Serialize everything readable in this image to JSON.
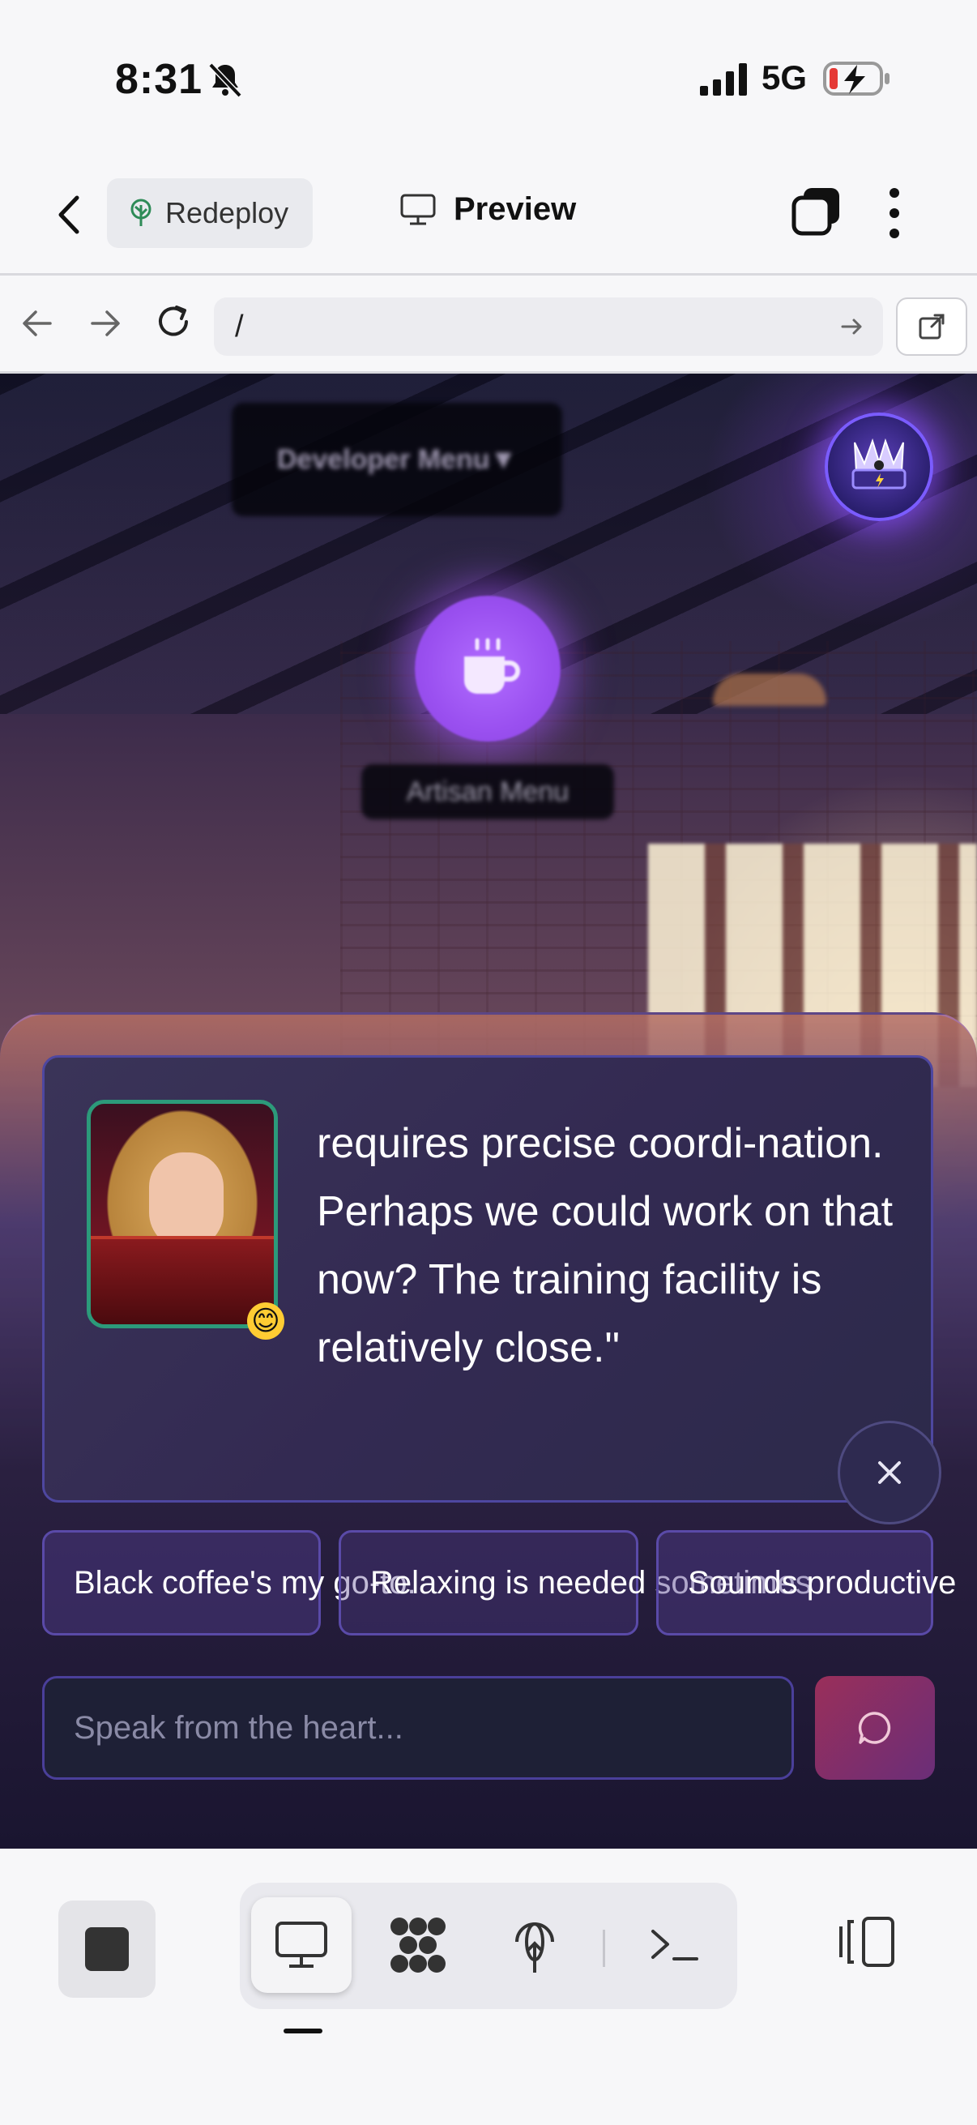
{
  "status": {
    "time": "8:31",
    "network": "5G"
  },
  "toolbar": {
    "redeploy_label": "Redeploy",
    "preview_label": "Preview"
  },
  "url_bar": {
    "value": "/"
  },
  "app": {
    "dev_menu_label": "Developer Menu▼",
    "artisan_menu_label": "Artisan Menu",
    "dialog_text": "requires precise coordi-nation. Perhaps we could work on that now? The training facility is relatively close.\"",
    "emoji": "😊",
    "chips": [
      "Black coffee's my go-to.",
      "Relaxing is needed sometimes",
      "Sounds productive"
    ],
    "speak_placeholder": "Speak from the heart..."
  },
  "colors": {
    "accent": "#9a50f0",
    "card_border": "#4e47a0",
    "portrait_border": "#2c9a7a"
  }
}
